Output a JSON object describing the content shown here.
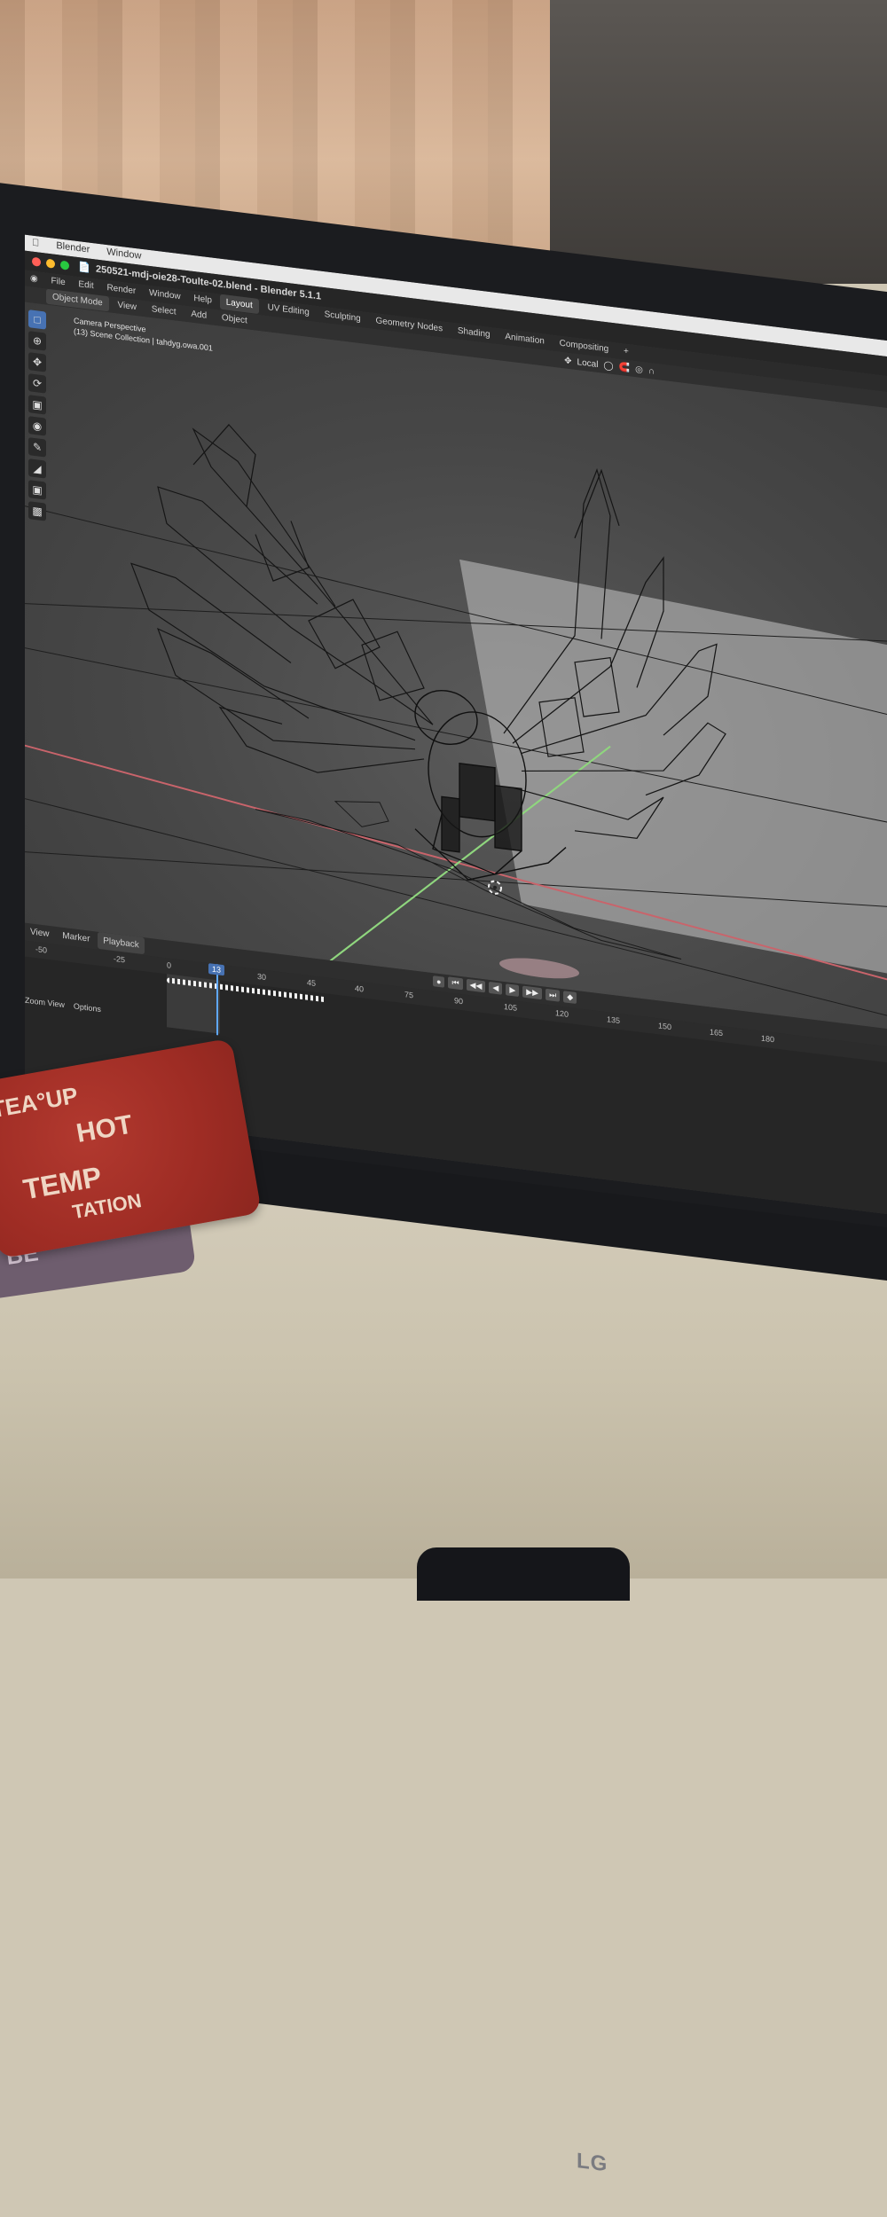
{
  "mac_menu": {
    "app": "Blender",
    "window": "Window"
  },
  "window": {
    "title": "250521-mdj-oie28-Toulte-02.blend - Blender 5.1.1"
  },
  "menu": {
    "items": [
      "File",
      "Edit",
      "Render",
      "Window",
      "Help"
    ],
    "workspaces": [
      "Layout",
      "UV Editing",
      "Sculpting",
      "Geometry Nodes",
      "Shading",
      "Animation",
      "Compositing"
    ],
    "active_workspace": "Layout",
    "add_tab": "+"
  },
  "header": {
    "mode": "Object Mode",
    "items": [
      "View",
      "Select",
      "Add",
      "Object"
    ],
    "transform_orientation": "Local"
  },
  "viewport": {
    "perspective": "Camera Perspective",
    "collection": "(13) Scene Collection | tahdyg.owa.001"
  },
  "timeline": {
    "menu": [
      "View",
      "Marker"
    ],
    "playback": "Playback",
    "ticks": [
      "-50",
      "-25",
      "0",
      "30",
      "45",
      "40",
      "75",
      "90",
      "105",
      "120",
      "135",
      "150",
      "165",
      "180"
    ],
    "current_frame": "13",
    "footer": [
      "Zoom View",
      "Options"
    ]
  },
  "coaster": {
    "line1": "TEA°UP",
    "line2": "HOT",
    "line3": "TEMP",
    "line4": "TATION",
    "back": "BE"
  },
  "brand": "LG",
  "colors": {
    "x_axis": "#c9646b",
    "y_axis": "#8fd67e",
    "accent": "#4772b3"
  }
}
